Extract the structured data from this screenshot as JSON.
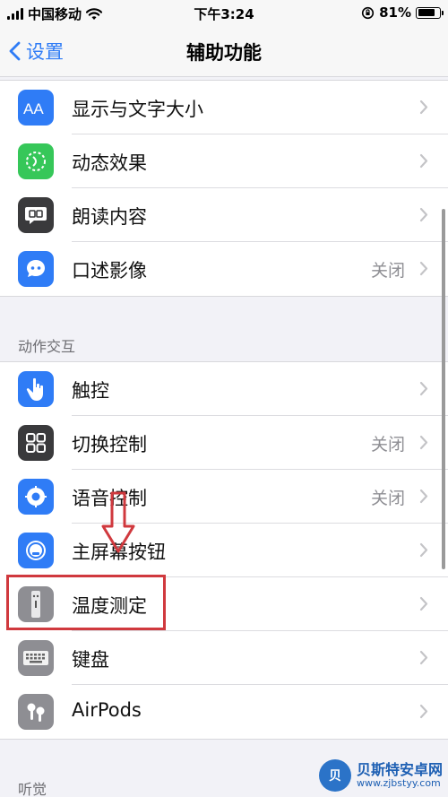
{
  "status_bar": {
    "carrier": "中国移动",
    "time": "下午3:24",
    "battery_percent": "81%",
    "battery_level": 0.81
  },
  "nav": {
    "back_label": "设置",
    "title": "辅助功能"
  },
  "vision_group": {
    "items": [
      {
        "label": "显示与文字大小",
        "value": "",
        "icon": "text-size-icon",
        "icon_color": "#2f7cf6"
      },
      {
        "label": "动态效果",
        "value": "",
        "icon": "motion-icon",
        "icon_color": "#36c759"
      },
      {
        "label": "朗读内容",
        "value": "",
        "icon": "speech-icon",
        "icon_color": "#3a3a3c"
      },
      {
        "label": "口述影像",
        "value": "关闭",
        "icon": "audio-description-icon",
        "icon_color": "#2f7cf6"
      }
    ]
  },
  "interaction_group": {
    "header": "动作交互",
    "items": [
      {
        "label": "触控",
        "value": "",
        "icon": "touch-icon",
        "icon_color": "#2f7cf6"
      },
      {
        "label": "切换控制",
        "value": "关闭",
        "icon": "switch-control-icon",
        "icon_color": "#3a3a3c"
      },
      {
        "label": "语音控制",
        "value": "关闭",
        "icon": "voice-control-icon",
        "icon_color": "#2f7cf6"
      },
      {
        "label": "主屏幕按钮",
        "value": "",
        "icon": "home-button-icon",
        "icon_color": "#2f7cf6"
      },
      {
        "label": "温度测定",
        "value": "",
        "icon": "remote-icon",
        "icon_color": "#8e8e93"
      },
      {
        "label": "键盘",
        "value": "",
        "icon": "keyboard-icon",
        "icon_color": "#8e8e93"
      },
      {
        "label": "AirPods",
        "value": "",
        "icon": "airpods-icon",
        "icon_color": "#8e8e93"
      }
    ]
  },
  "hearing_group": {
    "header": "听觉"
  },
  "watermark": {
    "logo_text": "贝",
    "title": "贝斯特安卓网",
    "url": "www.zjbstyy.com"
  }
}
